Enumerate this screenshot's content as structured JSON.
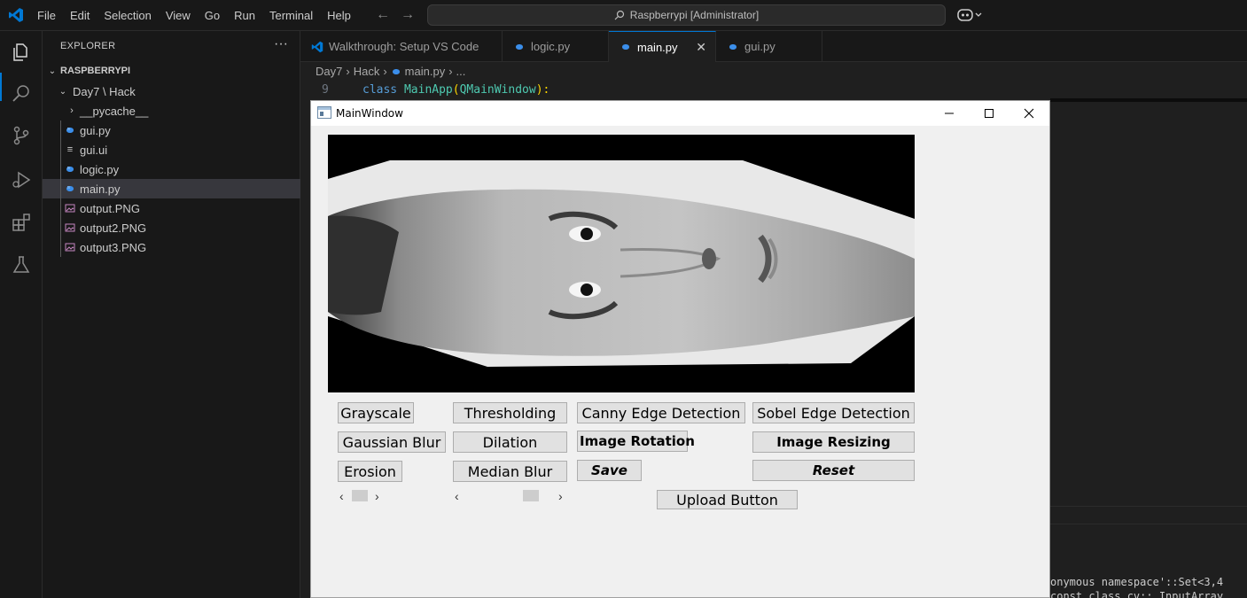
{
  "menu": [
    "File",
    "Edit",
    "Selection",
    "View",
    "Go",
    "Run",
    "Terminal",
    "Help"
  ],
  "command_center": "Raspberrypi [Administrator]",
  "explorer": {
    "title": "EXPLORER",
    "more": "···",
    "root": "RASPBERRYPI",
    "folder": "Day7 \\ Hack",
    "items": [
      {
        "label": "__pycache__",
        "kind": "folder"
      },
      {
        "label": "gui.py",
        "kind": "python"
      },
      {
        "label": "gui.ui",
        "kind": "text"
      },
      {
        "label": "logic.py",
        "kind": "python"
      },
      {
        "label": "main.py",
        "kind": "python",
        "selected": true
      },
      {
        "label": "output.PNG",
        "kind": "image"
      },
      {
        "label": "output2.PNG",
        "kind": "image"
      },
      {
        "label": "output3.PNG",
        "kind": "image"
      }
    ]
  },
  "tabs": [
    {
      "label": "Walkthrough: Setup VS Code",
      "icon": "vscode-icon"
    },
    {
      "label": "logic.py",
      "icon": "python-icon"
    },
    {
      "label": "main.py",
      "icon": "python-icon",
      "active": true
    },
    {
      "label": "gui.py",
      "icon": "python-icon"
    }
  ],
  "breadcrumb": {
    "seg1": "Day7",
    "seg2": "Hack",
    "seg3": "main.py",
    "seg4": "..."
  },
  "code": {
    "line_number": "9",
    "kw": "class",
    "name": "MainApp",
    "paren_open": "(",
    "base": "QMainWindow",
    "paren_close": "):"
  },
  "terminal": {
    "line1": "onymous namespace'::Set<3,4",
    "line2": "const class cv::_InputArray"
  },
  "qt_window": {
    "title": "MainWindow",
    "buttons": {
      "grayscale": "Grayscale",
      "thresholding": "Thresholding",
      "canny": "Canny Edge Detection",
      "sobel": "Sobel Edge Detection",
      "gaussian": "Gaussian Blur",
      "dilation": "Dilation",
      "rotation": "Image Rotation",
      "resizing": "Image Resizing",
      "erosion": "Erosion",
      "median": "Median Blur",
      "save": "Save",
      "reset": "Reset",
      "upload": "Upload Button"
    },
    "slider1_value": 0.0,
    "slider2_value": 0.7
  },
  "colors": {
    "accent": "#0078d4",
    "python": "#3b8eea",
    "image_icon": "#c586c0",
    "keyword": "#569cd6",
    "class_name": "#4ec9b0"
  }
}
